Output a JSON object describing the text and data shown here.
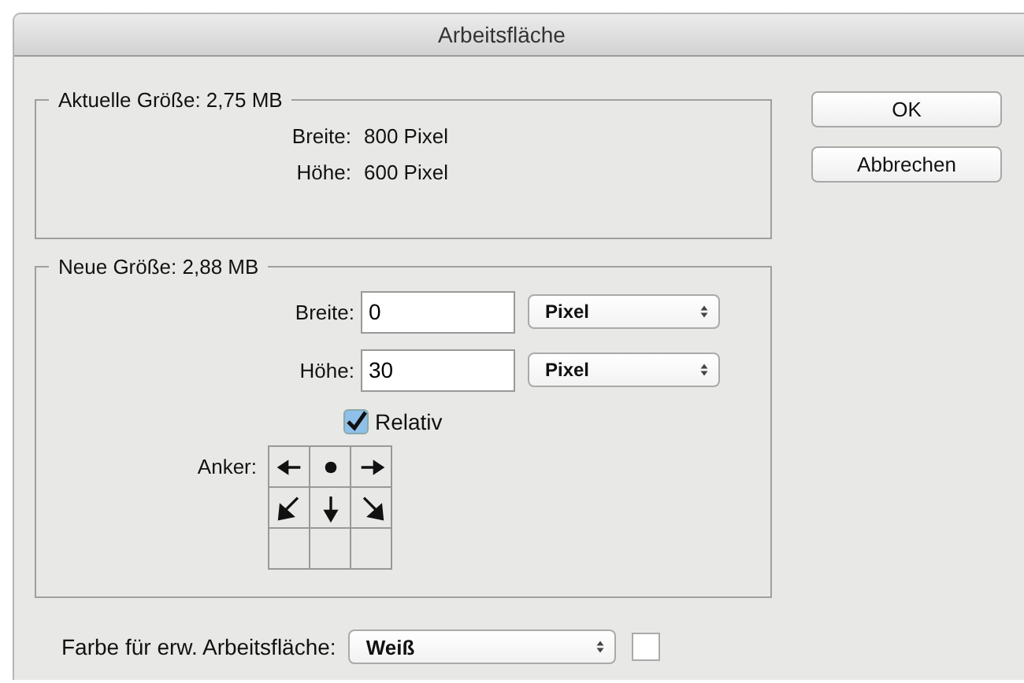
{
  "window": {
    "title": "Arbeitsfläche"
  },
  "current": {
    "legend": "Aktuelle Größe: 2,75 MB",
    "rows": [
      {
        "label": "Breite:",
        "value": "800 Pixel"
      },
      {
        "label": "Höhe:",
        "value": "600 Pixel"
      }
    ]
  },
  "new": {
    "legend": "Neue Größe: 2,88 MB",
    "fields": [
      {
        "label": "Breite:",
        "value": "0",
        "unit": "Pixel"
      },
      {
        "label": "Höhe:",
        "value": "30",
        "unit": "Pixel"
      }
    ],
    "relative": {
      "label": "Relativ",
      "checked": true
    },
    "anchor": {
      "label": "Anker:",
      "cells": [
        {
          "kind": "left"
        },
        {
          "kind": "center"
        },
        {
          "kind": "right"
        },
        {
          "kind": "down-left"
        },
        {
          "kind": "down"
        },
        {
          "kind": "down-right"
        },
        {
          "kind": "empty"
        },
        {
          "kind": "empty"
        },
        {
          "kind": "empty"
        }
      ]
    }
  },
  "buttons": [
    {
      "label": "OK"
    },
    {
      "label": "Abbrechen"
    }
  ],
  "extension_color": {
    "label": "Farbe für erw. Arbeitsfläche:",
    "value": "Weiß",
    "color": "#ffffff"
  }
}
